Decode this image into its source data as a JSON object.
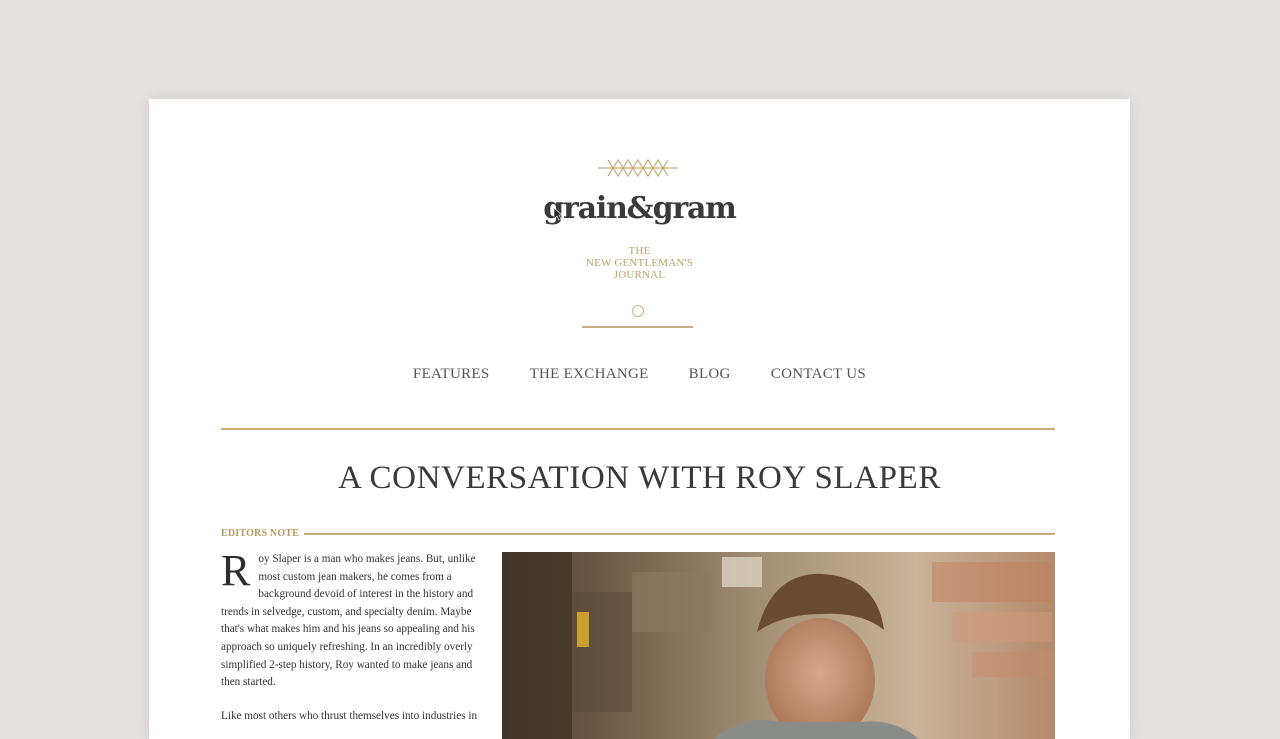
{
  "site": {
    "logo_text": "grain&gram",
    "tagline": [
      "THE",
      "NEW GENTLEMAN'S",
      "JOURNAL"
    ],
    "accent_color": "#c8ae76"
  },
  "nav": {
    "items": [
      {
        "label": "FEATURES"
      },
      {
        "label": "THE EXCHANGE"
      },
      {
        "label": "BLOG"
      },
      {
        "label": "CONTACT US"
      }
    ]
  },
  "article": {
    "title": "A CONVERSATION WITH ROY SLAPER",
    "section_label": "EDITORS NOTE",
    "dropcap": "R",
    "paragraph1": "oy Slaper is a man who makes jeans. But, unlike most custom jean makers, he comes from a background devoid of interest in the history and trends in selvedge, custom, and specialty denim. Maybe that's what makes him and his jeans so appealing and his approach so uniquely refreshing. In an incredibly overly simplified 2-step history, Roy wanted to make jeans and then started.",
    "paragraph2": "Like most others who thrust themselves into industries in",
    "photo_icon": "workshop-photo"
  }
}
